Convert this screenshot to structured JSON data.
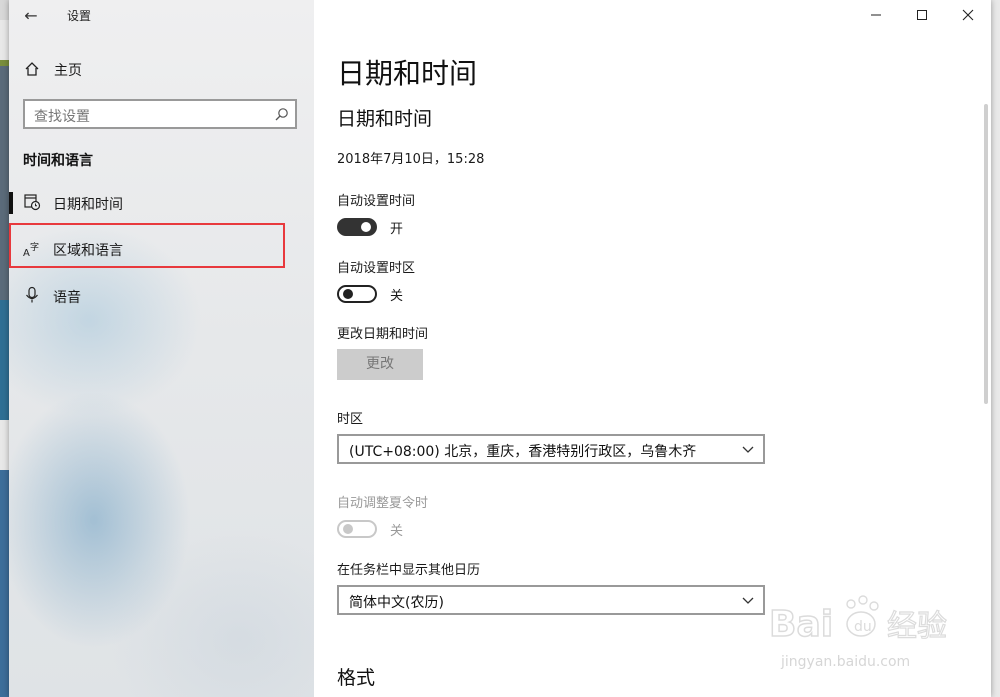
{
  "window": {
    "title": "设置",
    "minimize": "—",
    "maximize": "☐",
    "close": "✕"
  },
  "sidebar": {
    "home_label": "主页",
    "search_placeholder": "查找设置",
    "section_title": "时间和语言",
    "items": [
      {
        "label": "日期和时间",
        "icon": "clock-calendar-icon",
        "selected": true
      },
      {
        "label": "区域和语言",
        "icon": "language-icon",
        "selected": false
      },
      {
        "label": "语音",
        "icon": "microphone-icon",
        "selected": false
      }
    ]
  },
  "main": {
    "page_title": "日期和时间",
    "section_title": "日期和时间",
    "current_datetime": "2018年7月10日，15:28",
    "auto_time": {
      "label": "自动设置时间",
      "state": "开",
      "on": true
    },
    "auto_timezone": {
      "label": "自动设置时区",
      "state": "关",
      "on": false
    },
    "change_datetime": {
      "label": "更改日期和时间",
      "button": "更改"
    },
    "timezone": {
      "label": "时区",
      "value": "(UTC+08:00) 北京，重庆，香港特别行政区，乌鲁木齐"
    },
    "dst": {
      "label": "自动调整夏令时",
      "state": "关",
      "enabled": false
    },
    "calendar": {
      "label": "在任务栏中显示其他日历",
      "value": "简体中文(农历)"
    },
    "format_title": "格式"
  },
  "watermark": {
    "brand": "Baidu",
    "brand_cn": "经验",
    "url": "jingyan.baidu.com"
  },
  "colors": {
    "highlight_box": "#e8393d",
    "toggle_on": "#333333",
    "disabled": "#c8c8c8"
  }
}
